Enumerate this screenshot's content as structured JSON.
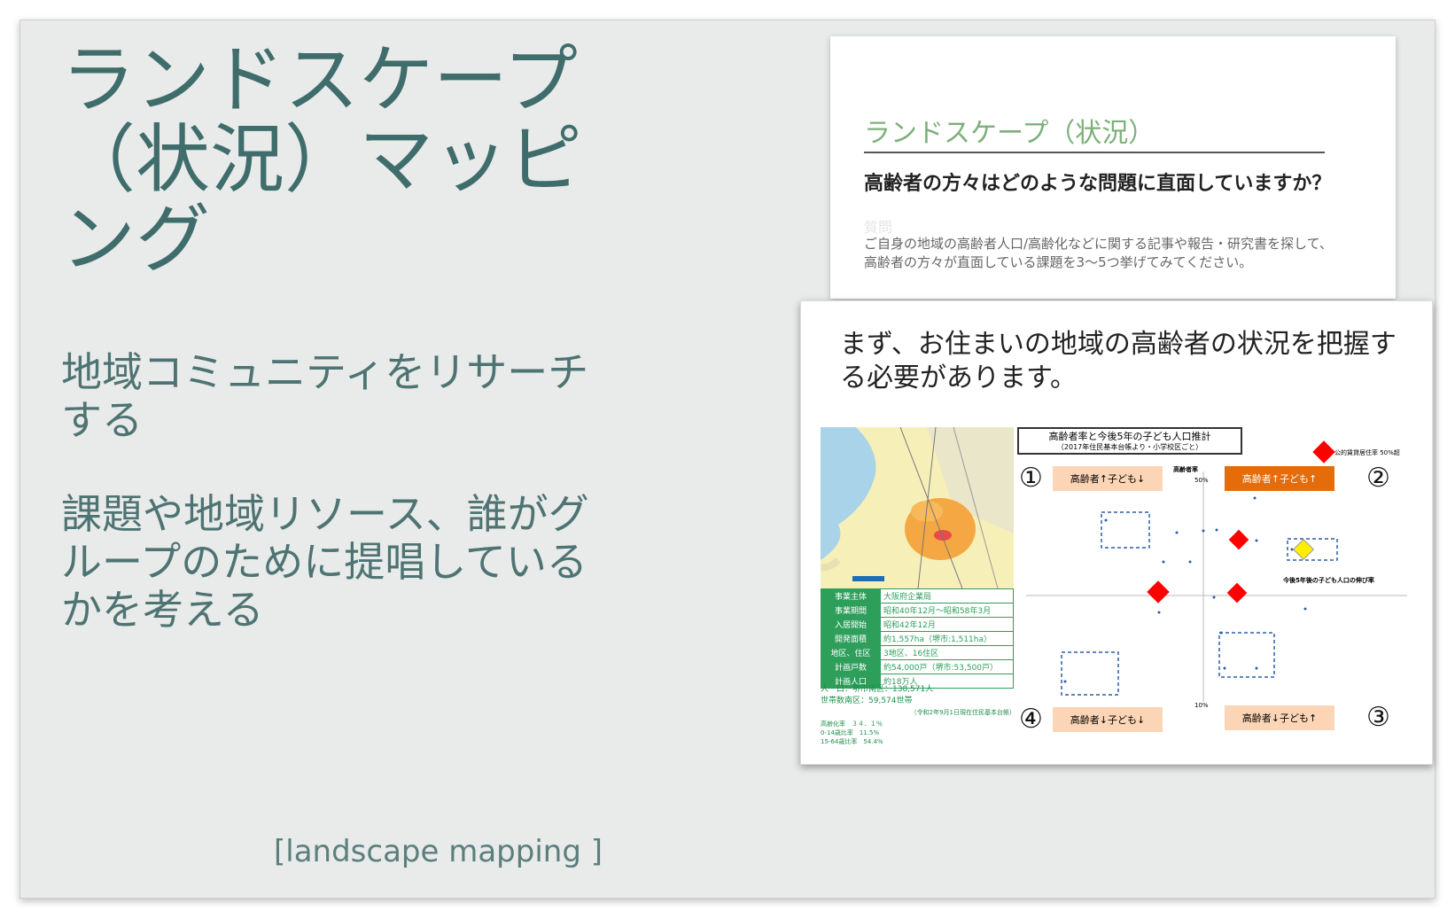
{
  "slide": {
    "title": "ランドスケープ（状況）マッピング",
    "bullets": [
      "地域コミュニティをリサーチする",
      "課題や地域リソース、誰がグループのために提唱しているかを考える"
    ],
    "caption": "[landscape mapping ]"
  },
  "card1": {
    "title": "ランドスケープ（状況）",
    "question": "高齢者の方々はどのような問題に直面していますか？",
    "faint_label": "質問",
    "body_lines": [
      "ご自身の地域の高齢者人口/高齢化などに関する記事や報告・研究書を探して、",
      "高齢者の方々が直面している課題を3〜5つ挙げてみてください。"
    ]
  },
  "card2": {
    "heading": "まず、お住まいの地域の高齢者の状況を把握する必要があります。",
    "info_rows": [
      {
        "k": "事業主体",
        "v": "大阪府企業局"
      },
      {
        "k": "事業期間",
        "v": "昭和40年12月〜昭和58年3月"
      },
      {
        "k": "入居開始",
        "v": "昭和42年12月"
      },
      {
        "k": "開発面積",
        "v": "約1,557ha（堺市:1,511ha）"
      },
      {
        "k": "地区、住区",
        "v": "3地区、16住区"
      },
      {
        "k": "計画戸数",
        "v": "約54,000戸（堺市:53,500戸）"
      },
      {
        "k": "計画人口",
        "v": "約18万人"
      }
    ],
    "population": [
      "人　口：堺市南区：138,571人",
      "世帯数南区：59,574世帯"
    ],
    "population_note": "（令和2年9月1日現在住民基本台帳）",
    "ratios": [
      "高齢化率　３４．１％",
      "0-14歳比率　11.5%",
      "15-64歳比率　54.4%"
    ],
    "chart": {
      "title": "高齢者率と今後5年の子ども人口推計",
      "subtitle": "（2017年住民基本台帳より・小学校区ごと）",
      "quadrants": [
        {
          "num": "①",
          "label": "高齢者↑子ども↓"
        },
        {
          "num": "②",
          "label": "高齢者↑子ども↑"
        },
        {
          "num": "③",
          "label": "高齢者↓子ども↑"
        },
        {
          "num": "④",
          "label": "高齢者↓子ども↓"
        }
      ],
      "legend": "公的賃貸居住率 50%超",
      "y_axis_label": "高齢者率",
      "x_axis_label": "今後5年後の子ども人口の伸び率",
      "y_ticks": [
        "50%",
        "10%"
      ]
    }
  },
  "colors": {
    "accent": "#3f6d6b",
    "green": "#2e9e5b",
    "orange": "#e46c0a",
    "peach": "#fbd5b5"
  }
}
